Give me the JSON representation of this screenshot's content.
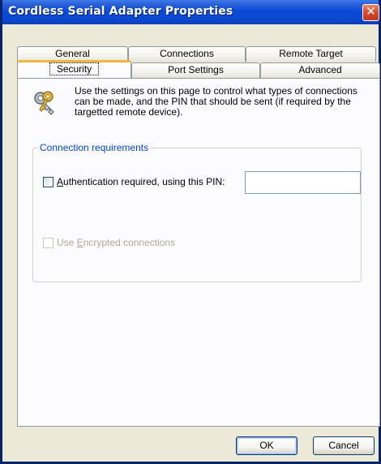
{
  "window": {
    "title": "Cordless Serial Adapter Properties",
    "close_glyph": "✕"
  },
  "tabs": {
    "row_back": [
      "General",
      "Connections",
      "Remote Target"
    ],
    "row_front": [
      "Security",
      "Port Settings",
      "Advanced"
    ],
    "active": "Security"
  },
  "security": {
    "icon": "key-icon",
    "intro": "Use the settings on this page to control what types of connections can be made, and the PIN that should be sent (if required by the targetted remote device).",
    "group_title": "Connection requirements",
    "auth_checkbox": {
      "prefix": "",
      "accel": "A",
      "rest": "uthentication required, using this PIN:",
      "checked": false
    },
    "pin_value": "",
    "encrypt_checkbox": {
      "prefix": "Use ",
      "accel": "E",
      "rest": "ncrypted connections",
      "checked": false,
      "enabled": false
    }
  },
  "buttons": {
    "ok": "OK",
    "cancel": "Cancel"
  },
  "colors": {
    "title_bar": "#0a4bd8",
    "active_tab_accent": "#f0b63c",
    "group_title": "#0046d5",
    "close_button": "#d4472b"
  }
}
